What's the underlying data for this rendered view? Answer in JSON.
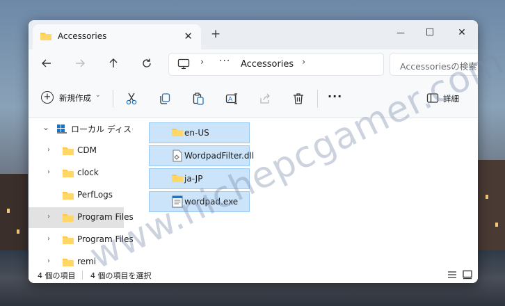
{
  "window": {
    "tab_title": "Accessories",
    "tab_close": "✕",
    "new_tab": "+",
    "controls": {
      "minimize": "—",
      "maximize": "☐",
      "close": "✕"
    }
  },
  "navigation": {
    "back_icon": "arrow-left-icon",
    "forward_icon": "arrow-right-icon",
    "up_icon": "arrow-up-icon",
    "refresh_icon": "refresh-icon",
    "address": {
      "pc_icon": "monitor-icon",
      "separator": "›",
      "more": "···",
      "current": "Accessories",
      "trailing_separator": "›"
    },
    "search_placeholder": "Accessoriesの検索"
  },
  "command_bar": {
    "new_label": "新規作成",
    "new_chevron": "⌄",
    "more": "···",
    "details_label": "詳細",
    "icons": [
      "cut-icon",
      "copy-icon",
      "paste-icon",
      "rename-icon",
      "share-icon",
      "delete-icon"
    ]
  },
  "sidebar": {
    "items": [
      {
        "label": "ローカル ディスク",
        "chevron": "⌄"
      },
      {
        "label": "CDM",
        "chevron": "›"
      },
      {
        "label": "clock",
        "chevron": "›"
      },
      {
        "label": "PerfLogs",
        "chevron": ""
      },
      {
        "label": "Program Files",
        "chevron": "›"
      },
      {
        "label": "Program Files",
        "chevron": "›"
      },
      {
        "label": "remi",
        "chevron": "›"
      }
    ]
  },
  "files": [
    {
      "name": "en-US",
      "type": "folder"
    },
    {
      "name": "WordpadFilter.dll",
      "type": "dll"
    },
    {
      "name": "ja-JP",
      "type": "folder"
    },
    {
      "name": "wordpad.exe",
      "type": "exe"
    }
  ],
  "status": {
    "item_count": "4 個の項目",
    "selected_count": "4 個の項目を選択"
  },
  "watermark": "www.nichepcgamer.com",
  "colors": {
    "selection_fill": "#cce4fa",
    "selection_border": "#99c8f2",
    "folder_yellow": "#ffc83d",
    "accent_blue": "#1a73c8"
  }
}
